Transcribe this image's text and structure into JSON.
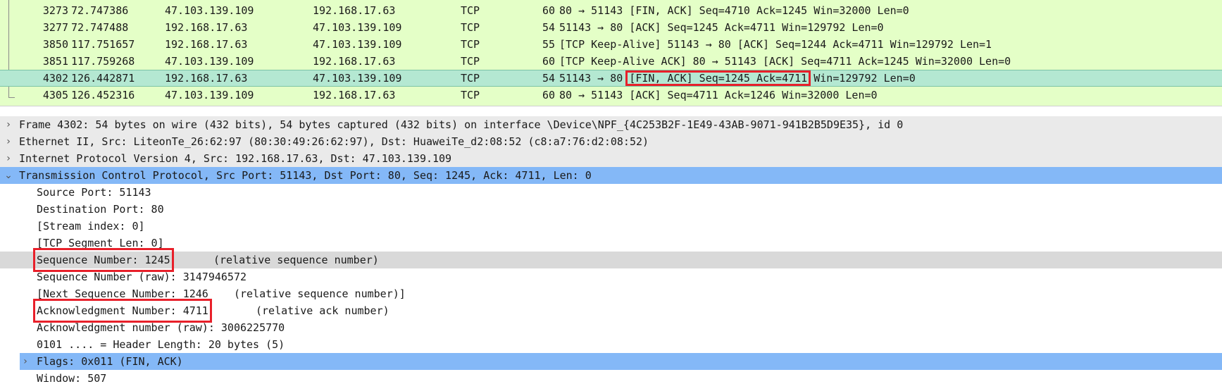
{
  "packet_list": {
    "rows": [
      {
        "no": "3273",
        "time": "72.747386",
        "src": "47.103.139.109",
        "dst": "192.168.17.63",
        "proto": "TCP",
        "len": "60",
        "info": "80 → 51143 [FIN, ACK] Seq=4710 Ack=1245 Win=32000 Len=0"
      },
      {
        "no": "3277",
        "time": "72.747488",
        "src": "192.168.17.63",
        "dst": "47.103.139.109",
        "proto": "TCP",
        "len": "54",
        "info": "51143 → 80 [ACK] Seq=1245 Ack=4711 Win=129792 Len=0"
      },
      {
        "no": "3850",
        "time": "117.751657",
        "src": "192.168.17.63",
        "dst": "47.103.139.109",
        "proto": "TCP",
        "len": "55",
        "info": "[TCP Keep-Alive] 51143 → 80 [ACK] Seq=1244 Ack=4711 Win=129792 Len=1"
      },
      {
        "no": "3851",
        "time": "117.759268",
        "src": "47.103.139.109",
        "dst": "192.168.17.63",
        "proto": "TCP",
        "len": "60",
        "info": "[TCP Keep-Alive ACK] 80 → 51143 [ACK] Seq=4711 Ack=1245 Win=32000 Len=0"
      },
      {
        "no": "4302",
        "time": "126.442871",
        "src": "192.168.17.63",
        "dst": "47.103.139.109",
        "proto": "TCP",
        "len": "54",
        "info_pre": "51143 → 80 ",
        "info_hl": "[FIN, ACK] Seq=1245 Ack=4711",
        "info_post": " Win=129792 Len=0"
      },
      {
        "no": "4305",
        "time": "126.452316",
        "src": "47.103.139.109",
        "dst": "192.168.17.63",
        "proto": "TCP",
        "len": "60",
        "info": "80 → 51143 [ACK] Seq=4711 Ack=1246 Win=32000 Len=0"
      }
    ]
  },
  "details": {
    "frame": "Frame 4302: 54 bytes on wire (432 bits), 54 bytes captured (432 bits) on interface \\Device\\NPF_{4C253B2F-1E49-43AB-9071-941B2B5D9E35}, id 0",
    "ethernet": "Ethernet II, Src: LiteonTe_26:62:97 (80:30:49:26:62:97), Dst: HuaweiTe_d2:08:52 (c8:a7:76:d2:08:52)",
    "ip": "Internet Protocol Version 4, Src: 192.168.17.63, Dst: 47.103.139.109",
    "tcp": "Transmission Control Protocol, Src Port: 51143, Dst Port: 80, Seq: 1245, Ack: 4711, Len: 0",
    "fields": {
      "src_port": "Source Port: 51143",
      "dst_port": "Destination Port: 80",
      "stream_index": "[Stream index: 0]",
      "segment_len": "[TCP Segment Len: 0]",
      "seq": "Sequence Number: 1245",
      "seq_suffix": "(relative sequence number)",
      "seq_raw": "Sequence Number (raw): 3147946572",
      "next_seq": "[Next Sequence Number: 1246    (relative sequence number)]",
      "ack": "Acknowledgment Number: 4711",
      "ack_suffix": "(relative ack number)",
      "ack_raw": "Acknowledgment number (raw): 3006225770",
      "header_len": "0101 .... = Header Length: 20 bytes (5)",
      "flags": "Flags: 0x011 (FIN, ACK)",
      "window": "Window: 507"
    },
    "icons": {
      "collapsed": "chevron-right-icon",
      "expanded": "chevron-down-icon"
    }
  },
  "colors": {
    "list_bg": "#e4ffc7",
    "selected_row": "#b4e8d2",
    "highlight_blue": "#84b8f7",
    "annotation_red": "#e8202a"
  }
}
